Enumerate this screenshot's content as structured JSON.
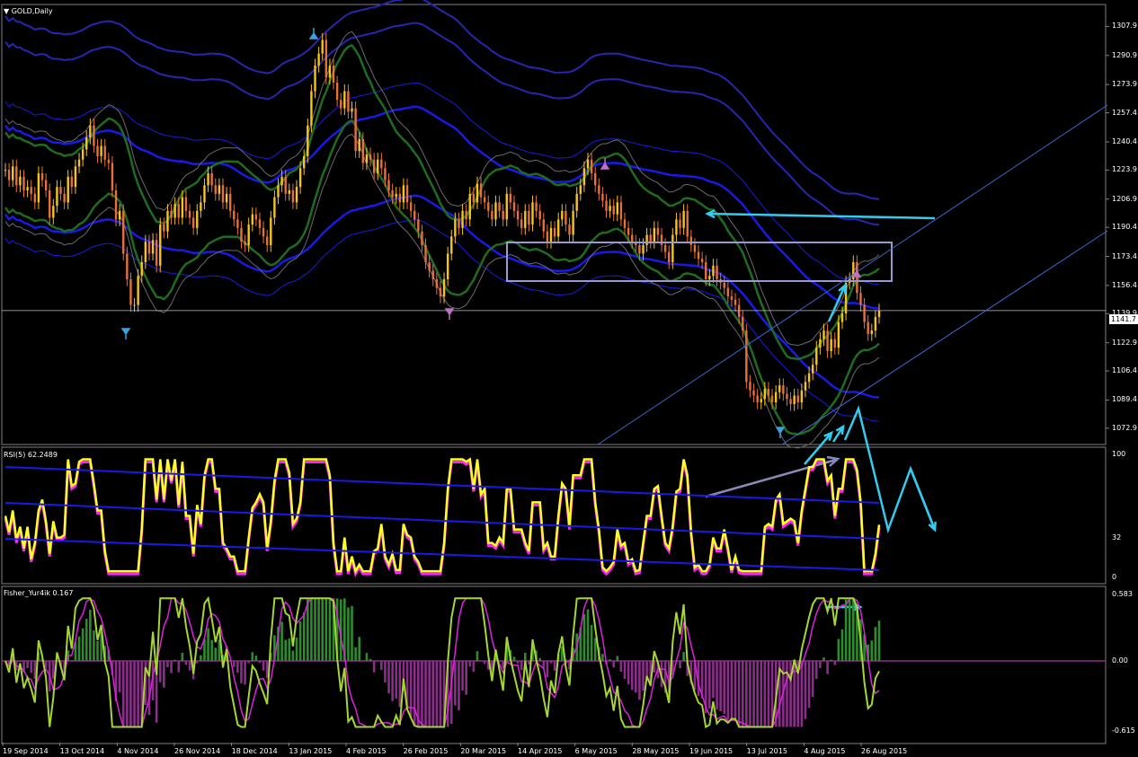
{
  "colors": {
    "background": "#000000",
    "candle_up": "#f5c518",
    "candle_down": "#e8713a",
    "band_blue": "#1a1ae6",
    "band_green": "#1f6b1f",
    "band_gray": "#8a8a8a",
    "annotation_cyan": "#33ccee",
    "rsi_yellow": "#ffff22",
    "rsi_magenta": "#ff22ff",
    "fisher_green": "#a6d632",
    "fisher_magenta": "#dd22dd",
    "hist_green": "#2e8b2e",
    "hist_purple": "#8b2e8b"
  },
  "main_pane": {
    "title": "GOLD,Daily",
    "current_price": "1141.7",
    "price_ticks": [
      "1307.9",
      "1290.9",
      "1273.9",
      "1257.4",
      "1240.4",
      "1223.9",
      "1206.9",
      "1190.4",
      "1173.4",
      "1156.4",
      "1139.9",
      "1122.9",
      "1106.4",
      "1089.4",
      "1072.9"
    ]
  },
  "rsi_pane": {
    "title": "RSI(5) 62.2489",
    "ticks": [
      "100",
      "32",
      "0"
    ]
  },
  "fisher_pane": {
    "title": "Fisher_Yur4ik 0.167",
    "ticks": [
      "0.583",
      "0.00",
      "-0.615"
    ]
  },
  "date_axis": [
    "19 Sep 2014",
    "13 Oct 2014",
    "4 Nov 2014",
    "26 Nov 2014",
    "18 Dec 2014",
    "13 Jan 2015",
    "4 Feb 2015",
    "26 Feb 2015",
    "20 Mar 2015",
    "14 Apr 2015",
    "6 May 2015",
    "28 May 2015",
    "19 Jun 2015",
    "13 Jul 2015",
    "4 Aug 2015",
    "26 Aug 2015"
  ],
  "chart_data": {
    "type": "candlestick",
    "symbol": "GOLD",
    "timeframe": "Daily",
    "ylim": [
      1066,
      1316
    ],
    "closes": [
      1224,
      1218,
      1226,
      1215,
      1220,
      1212,
      1214,
      1210,
      1205,
      1222,
      1218,
      1212,
      1196,
      1203,
      1214,
      1210,
      1205,
      1220,
      1214,
      1226,
      1230,
      1236,
      1243,
      1250,
      1238,
      1232,
      1238,
      1230,
      1228,
      1212,
      1195,
      1200,
      1175,
      1160,
      1145,
      1145,
      1162,
      1170,
      1182,
      1175,
      1183,
      1168,
      1192,
      1188,
      1200,
      1196,
      1204,
      1196,
      1208,
      1200,
      1196,
      1190,
      1200,
      1205,
      1215,
      1222,
      1215,
      1210,
      1215,
      1205,
      1210,
      1200,
      1195,
      1190,
      1182,
      1180,
      1192,
      1198,
      1195,
      1190,
      1185,
      1180,
      1196,
      1208,
      1215,
      1220,
      1210,
      1212,
      1205,
      1214,
      1225,
      1232,
      1250,
      1270,
      1285,
      1292,
      1300,
      1278,
      1285,
      1275,
      1265,
      1260,
      1270,
      1258,
      1260,
      1235,
      1242,
      1228,
      1233,
      1230,
      1222,
      1230,
      1225,
      1218,
      1212,
      1208,
      1210,
      1205,
      1215,
      1205,
      1200,
      1195,
      1188,
      1180,
      1170,
      1165,
      1160,
      1155,
      1150,
      1160,
      1175,
      1185,
      1195,
      1190,
      1200,
      1195,
      1210,
      1205,
      1216,
      1208,
      1205,
      1200,
      1195,
      1205,
      1200,
      1195,
      1210,
      1205,
      1200,
      1195,
      1190,
      1200,
      1192,
      1205,
      1200,
      1195,
      1188,
      1182,
      1190,
      1185,
      1195,
      1200,
      1192,
      1186,
      1200,
      1210,
      1215,
      1225,
      1230,
      1222,
      1215,
      1210,
      1206,
      1200,
      1203,
      1198,
      1205,
      1195,
      1190,
      1186,
      1182,
      1180,
      1175,
      1180,
      1186,
      1182,
      1190,
      1186,
      1180,
      1176,
      1170,
      1186,
      1195,
      1190,
      1200,
      1185,
      1180,
      1176,
      1172,
      1170,
      1160,
      1162,
      1168,
      1160,
      1158,
      1155,
      1150,
      1148,
      1145,
      1138,
      1130,
      1100,
      1095,
      1092,
      1088,
      1090,
      1096,
      1092,
      1088,
      1094,
      1098,
      1093,
      1090,
      1087,
      1092,
      1088,
      1095,
      1100,
      1105,
      1110,
      1120,
      1125,
      1130,
      1118,
      1125,
      1120,
      1135,
      1140,
      1158,
      1160,
      1170,
      1152,
      1145,
      1135,
      1128,
      1130,
      1138,
      1141.7
    ]
  }
}
